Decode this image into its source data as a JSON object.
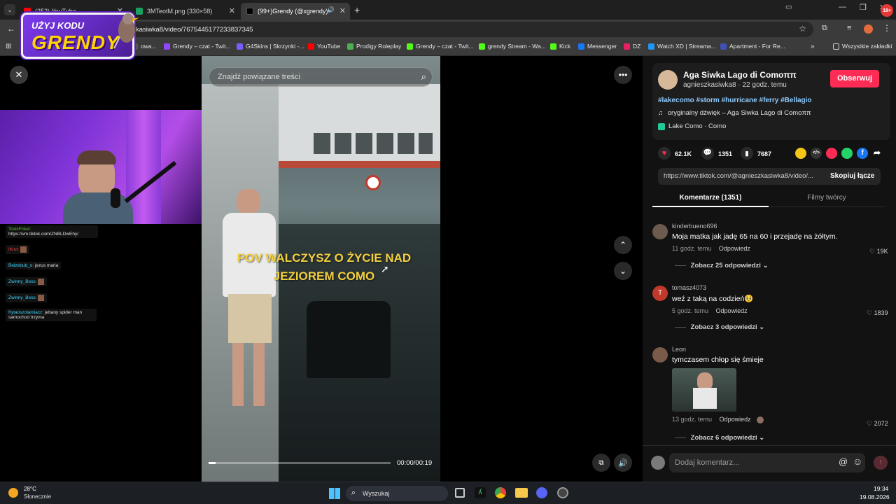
{
  "browser": {
    "tabs": [
      {
        "label": "(252) YouTube",
        "color": "#ff0000"
      },
      {
        "label": "3MTeotM.png (330×58)",
        "color": "#1aa260"
      },
      {
        "label": "(99+)Grendy (@xgrendy) | T",
        "color": "#000000"
      }
    ],
    "url": "kasiwka8/video/7675445177233837345",
    "bookmarks": [
      {
        "label": "owa...",
        "color": "#555555"
      },
      {
        "label": "Grendy – czat - Twit...",
        "color": "#9146ff"
      },
      {
        "label": "G4Skins | Skrzynki -...",
        "color": "#7b5cff"
      },
      {
        "label": "YouTube",
        "color": "#ff0000"
      },
      {
        "label": "Prodigy Roleplay",
        "color": "#4caf50"
      },
      {
        "label": "Grendy – czat - Twit...",
        "color": "#53fc18"
      },
      {
        "label": "grendy Stream - Wa...",
        "color": "#53fc18"
      },
      {
        "label": "Kick",
        "color": "#53fc18"
      },
      {
        "label": "Messenger",
        "color": "#1877f2"
      },
      {
        "label": "DZ",
        "color": "#e91e63"
      },
      {
        "label": "Watch XD | Streama...",
        "color": "#2196f3"
      },
      {
        "label": "Apartment - For Re...",
        "color": "#3f51b5"
      }
    ],
    "all_bookmarks": "Wszystkie zakładki"
  },
  "promo": {
    "line1": "UŻYJ KODU",
    "line2": "GRENDY"
  },
  "video": {
    "search_placeholder": "Znajdź powiązane treści",
    "caption_line1": "POV WALCZYSZ O ŻYCIE NAD",
    "caption_line2": "JEZIOREM COMO",
    "time": "00:00/00:19",
    "progress": 0.04
  },
  "chat": [
    {
      "user": "ToxicFcker:",
      "text": "https://vm.tiktok.com/ZNBLDwEhy/",
      "color": "#5bc236"
    },
    {
      "user": "iKrut:",
      "text": "",
      "color": "#ff4040"
    },
    {
      "user": "Belzebub_o:",
      "text": "jezus maria",
      "color": "#3cd6ff"
    },
    {
      "user": "Zwinny_Boss:",
      "text": "",
      "color": "#3cd6ff"
    },
    {
      "user": "Zwinny_Boss:",
      "text": "",
      "color": "#3cd6ff"
    },
    {
      "user": "frytaoszolamiacz:",
      "text": "jebany spider man samochod trzyma",
      "color": "#3cd6ff"
    }
  ],
  "post": {
    "author": "Aga Siwka Lago di Comoππ",
    "handle_time": "agnieszkasiwka8 · 22 godz. temu",
    "follow": "Obserwuj",
    "hashtags": "#lakecomo #storm #hurricane #ferry #Bellagio",
    "sound": "oryginalny dźwięk – Aga Siwka Lago di Comoππ",
    "location": "Lake Como · Como",
    "likes": "62.1K",
    "comments": "1351",
    "saves": "7687",
    "link": "https://www.tiktok.com/@agnieszkasiwka8/video/...",
    "copy_link": "Skopiuj łącze",
    "tab_comments": "Komentarze (1351)",
    "tab_videos": "Filmy twórcy"
  },
  "comments": [
    {
      "name": "kinderbueno696",
      "text": "Moja matka jak jadę 65 na 60 i przejadę na żółtym.",
      "time": "11 godz. temu",
      "reply": "Odpowiedz",
      "likes": "19K",
      "more": "Zobacz 25 odpowiedzi",
      "avatar_color": "#6d5a4f",
      "initial": ""
    },
    {
      "name": "tomasz4073",
      "text": "weź z taką na codzień🥺",
      "time": "5 godz. temu",
      "reply": "Odpowiedz",
      "likes": "1839",
      "more": "Zobacz 3 odpowiedzi",
      "avatar_color": "#c0392b",
      "initial": "T"
    },
    {
      "name": "Leon",
      "text": "tymczasem chłop się śmieje",
      "time": "13 godz. temu",
      "reply": "Odpowiedz",
      "likes": "2072",
      "more": "Zobacz 6 odpowiedzi",
      "avatar_color": "#7a5a48",
      "initial": ""
    }
  ],
  "add_comment": "Dodaj komentarz...",
  "taskbar": {
    "temp": "28°C",
    "weather": "Słonecznie",
    "search": "Wyszukaj",
    "time": "19:34",
    "date": "19.08.2026"
  },
  "colors": {
    "follow": "#fe2c55",
    "accent_tab": "#ffffff"
  }
}
